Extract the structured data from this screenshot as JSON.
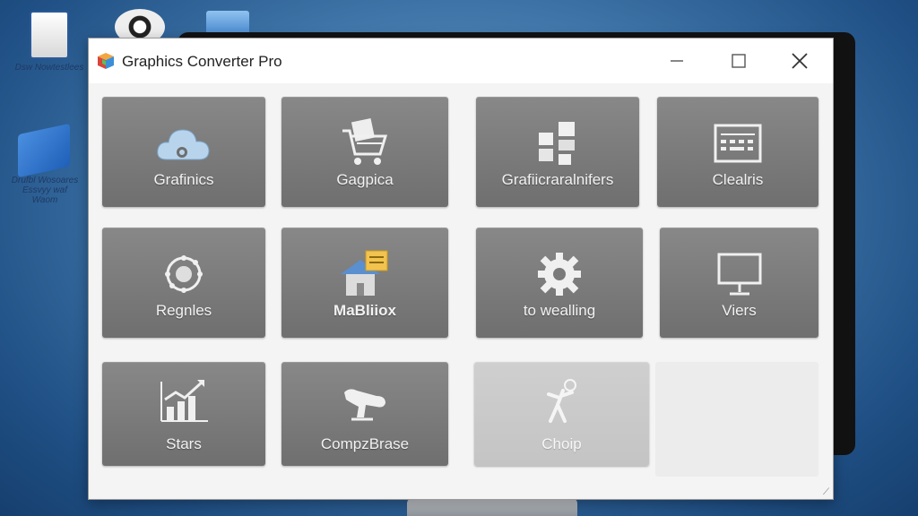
{
  "desktop": {
    "icons": [
      {
        "label": "Dsw Nowtestlees"
      },
      {
        "label": "Drufbl Wosoares Essvyy waf Waom"
      }
    ]
  },
  "window": {
    "title": "Graphics Converter Pro",
    "buttons": {
      "minimize": "minimize-icon",
      "maximize": "maximize-icon",
      "close": "close-icon"
    },
    "tiles": [
      {
        "label": "Grafinics",
        "icon": "cloud-icon"
      },
      {
        "label": "Gagpica",
        "icon": "shopping-cart-icon"
      },
      {
        "label": "Grafiicraralnifers",
        "icon": "document-pages-icon"
      },
      {
        "label": "Clealris",
        "icon": "keyboard-screen-icon"
      },
      {
        "label": "Regnles",
        "icon": "network-node-icon"
      },
      {
        "label": "MaBliiox",
        "icon": "house-note-icon"
      },
      {
        "label": "to wealling",
        "icon": "gear-icon"
      },
      {
        "label": "Viers",
        "icon": "monitor-icon"
      },
      {
        "label": "Stars",
        "icon": "bar-chart-trend-icon"
      },
      {
        "label": "CompzBrase",
        "icon": "animal-icon"
      },
      {
        "label": "Choip",
        "icon": "figure-icon"
      }
    ]
  },
  "colors": {
    "tile": "#7c7c7c",
    "tile_light": "#c9c9c9",
    "window_bg": "#f4f4f4",
    "desktop": "#3f75a8"
  }
}
